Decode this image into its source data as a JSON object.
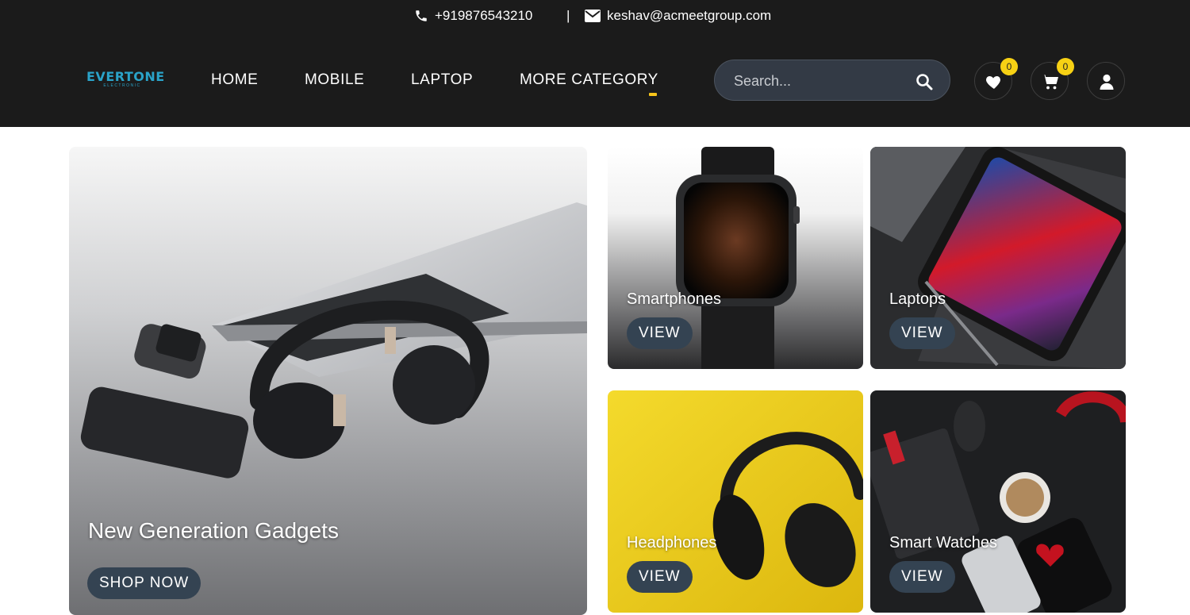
{
  "topbar": {
    "phone": "+919876543210",
    "separator": "|",
    "email": "keshav@acmeetgroup.com"
  },
  "logo": {
    "brand": "EVERTONE",
    "subtitle": "ELECTRONIC"
  },
  "nav": {
    "items": [
      {
        "label": "HOME"
      },
      {
        "label": "MOBILE"
      },
      {
        "label": "LAPTOP"
      },
      {
        "label": "MORE CATEGORY"
      }
    ]
  },
  "search": {
    "placeholder": "Search..."
  },
  "header_icons": {
    "wishlist_count": "0",
    "cart_count": "0"
  },
  "hero": {
    "title": "New Generation Gadgets",
    "button": "SHOP NOW"
  },
  "categories": [
    {
      "title": "Smartphones",
      "button": "VIEW"
    },
    {
      "title": "Laptops",
      "button": "VIEW"
    },
    {
      "title": "Headphones",
      "button": "VIEW"
    },
    {
      "title": "Smart Watches",
      "button": "VIEW"
    }
  ],
  "colors": {
    "header_bg": "#1b1b1b",
    "accent_yellow": "#f7d114",
    "logo_blue": "#2aa3c9",
    "button_bg": "#344352"
  }
}
